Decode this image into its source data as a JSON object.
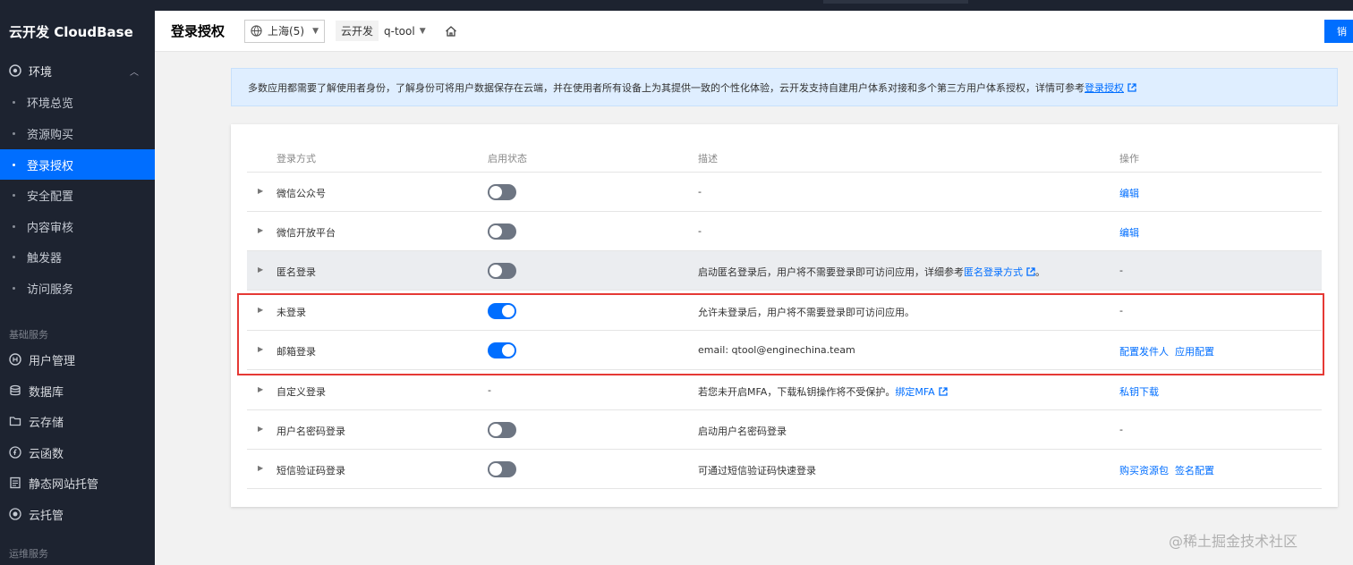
{
  "sidebar": {
    "brand": "云开发 CloudBase",
    "env_label": "环境",
    "nav": [
      {
        "label": "环境总览"
      },
      {
        "label": "资源购买"
      },
      {
        "label": "登录授权"
      },
      {
        "label": "安全配置"
      },
      {
        "label": "内容审核"
      },
      {
        "label": "触发器"
      },
      {
        "label": "访问服务"
      }
    ],
    "section_basic": "基础服务",
    "services": [
      {
        "label": "用户管理",
        "icon": "user-icon"
      },
      {
        "label": "数据库",
        "icon": "database-icon"
      },
      {
        "label": "云存储",
        "icon": "folder-icon"
      },
      {
        "label": "云函数",
        "icon": "function-icon"
      },
      {
        "label": "静态网站托管",
        "icon": "website-icon"
      },
      {
        "label": "云托管",
        "icon": "cloud-host-icon"
      }
    ],
    "section_ops": "运维服务"
  },
  "header": {
    "title": "登录授权",
    "region": "上海(5)",
    "env_tag": "云开发",
    "env_name": "q-tool",
    "top_button": "销"
  },
  "notice": {
    "text": "多数应用都需要了解使用者身份，了解身份可将用户数据保存在云端，并在使用者所有设备上为其提供一致的个性化体验，云开发支持自建用户体系对接和多个第三方用户体系授权，详情可参考",
    "link": "登录授权"
  },
  "table": {
    "headers": [
      "登录方式",
      "启用状态",
      "描述",
      "操作"
    ],
    "rows": [
      {
        "method": "微信公众号",
        "desc": "-",
        "actions": [
          "编辑"
        ]
      },
      {
        "method": "微信开放平台",
        "desc": "-",
        "actions": [
          "编辑"
        ]
      },
      {
        "method": "匿名登录",
        "desc_pre": "启动匿名登录后，用户将不需要登录即可访问应用，详细参考",
        "desc_link": "匿名登录方式",
        "desc_post": "。",
        "op_text": "-"
      },
      {
        "method": "未登录",
        "desc": "允许未登录后，用户将不需要登录即可访问应用。",
        "op_text": "-"
      },
      {
        "method": "邮箱登录",
        "desc": "email: qtool@enginechina.team",
        "actions": [
          "配置发件人",
          "应用配置"
        ]
      },
      {
        "method": "自定义登录",
        "status_text": "-",
        "desc_pre": "若您未开启MFA，下载私钥操作将不受保护。",
        "desc_link": "绑定MFA",
        "actions": [
          "私钥下载"
        ]
      },
      {
        "method": "用户名密码登录",
        "desc": "启动用户名密码登录",
        "op_text": "-"
      },
      {
        "method": "短信验证码登录",
        "desc": "可通过短信验证码快速登录",
        "actions": [
          "购买资源包",
          "签名配置"
        ]
      }
    ],
    "toggles": [
      false,
      false,
      false,
      true,
      true,
      null,
      false,
      false
    ]
  },
  "watermark": "@稀土掘金技术社区",
  "colors": {
    "accent": "#006eff",
    "sidebar_bg": "#1d2330",
    "highlight": "#e53935"
  }
}
